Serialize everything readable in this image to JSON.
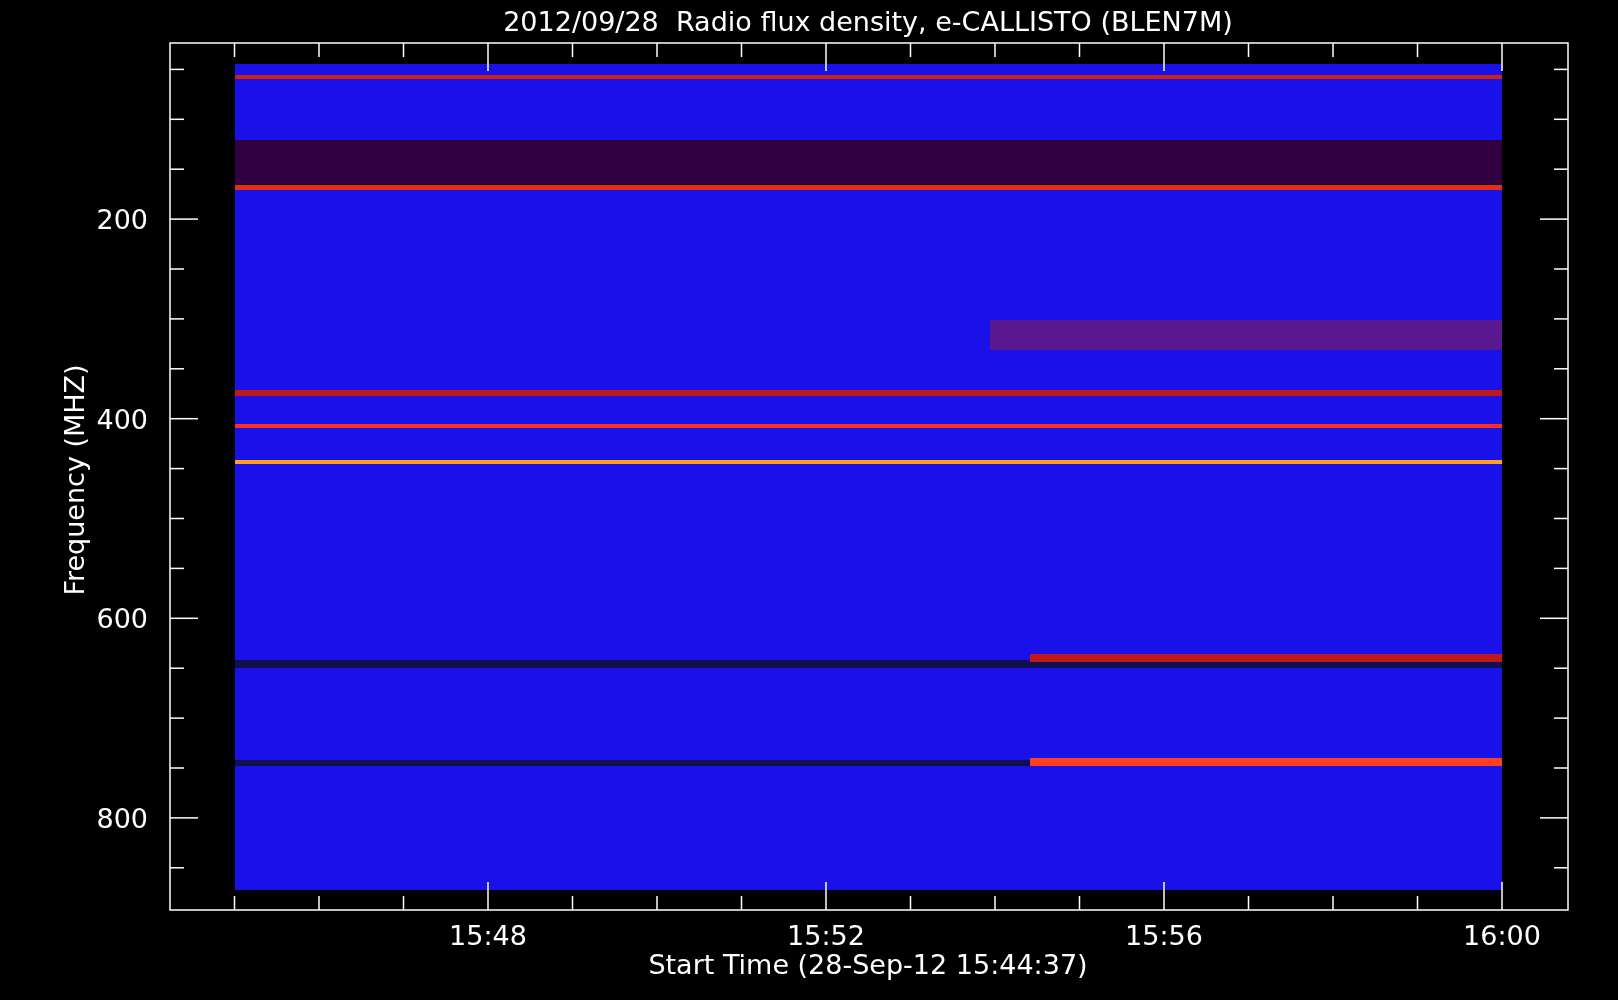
{
  "title": "2012/09/28  Radio flux density, e-CALLISTO (BLEN7M)",
  "y_axis": {
    "label": "Frequency (MHZ)",
    "ticks": [
      "200",
      "400",
      "600",
      "800"
    ]
  },
  "x_axis": {
    "label": "Start Time (28-Sep-12 15:44:37)",
    "ticks": [
      "15:48",
      "15:52",
      "15:56",
      "16:00"
    ]
  }
}
